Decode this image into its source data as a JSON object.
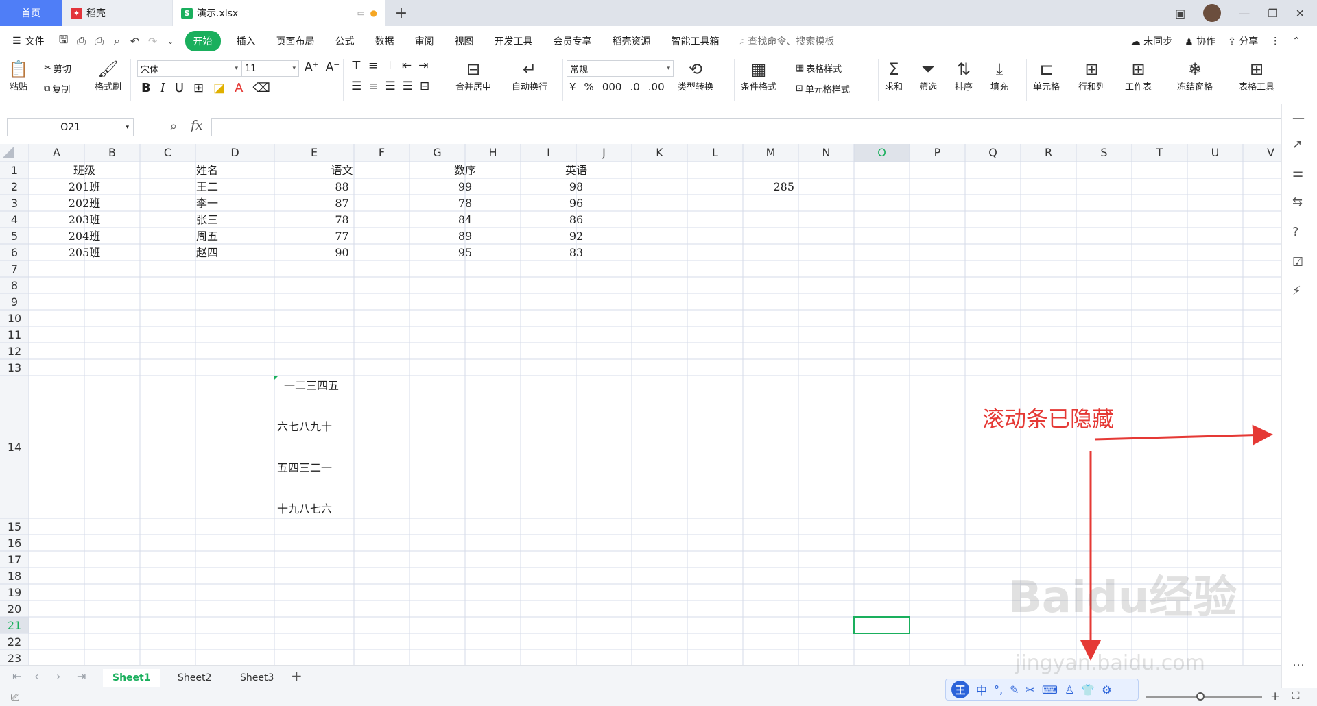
{
  "tabs": {
    "home": "首页",
    "daoke": "稻壳",
    "file": "演示.xlsx"
  },
  "menu": {
    "file": "文件",
    "items": [
      "开始",
      "插入",
      "页面布局",
      "公式",
      "数据",
      "审阅",
      "视图",
      "开发工具",
      "会员专享",
      "稻壳资源",
      "智能工具箱"
    ],
    "search_placeholder": "查找命令、搜索模板",
    "sync": "未同步",
    "collab": "协作",
    "share": "分享"
  },
  "ribbon": {
    "paste": "粘贴",
    "cut": "剪切",
    "copy": "复制",
    "format_painter": "格式刷",
    "font_name": "宋体",
    "font_size": "11",
    "merge": "合并居中",
    "wrap": "自动换行",
    "number_format": "常规",
    "type_convert": "类型转换",
    "cond_format": "条件格式",
    "table_style": "表格样式",
    "cell_style": "单元格样式",
    "sum": "求和",
    "filter": "筛选",
    "sort": "排序",
    "fill": "填充",
    "cell": "单元格",
    "rowcol": "行和列",
    "sheet": "工作表",
    "freeze": "冻结窗格",
    "table_tools": "表格工具"
  },
  "formula_bar": {
    "name_box": "O21",
    "fx": "fx"
  },
  "grid": {
    "columns": [
      "A",
      "B",
      "C",
      "D",
      "E",
      "F",
      "G",
      "H",
      "I",
      "J",
      "K",
      "L",
      "M",
      "N",
      "O",
      "P",
      "Q",
      "R",
      "S",
      "T",
      "U",
      "V"
    ],
    "rows": [
      "1",
      "2",
      "3",
      "4",
      "5",
      "6",
      "7",
      "8",
      "9",
      "10",
      "11",
      "12",
      "13",
      "14",
      "15",
      "16",
      "17",
      "18",
      "19",
      "20",
      "21",
      "22",
      "23"
    ],
    "active_cell": "O21",
    "header": [
      "班级",
      "姓名",
      "语文",
      "数序",
      "英语"
    ],
    "data": [
      [
        "201班",
        "王二",
        "88",
        "99",
        "98"
      ],
      [
        "202班",
        "李一",
        "87",
        "78",
        "96"
      ],
      [
        "203班",
        "张三",
        "78",
        "84",
        "86"
      ],
      [
        "204班",
        "周五",
        "77",
        "89",
        "92"
      ],
      [
        "205班",
        "赵四",
        "90",
        "95",
        "83"
      ]
    ],
    "m2_value": "285",
    "e14_lines": [
      "一二三四五",
      "六七八九十",
      "五四三二一",
      "十九八七六"
    ]
  },
  "sheets": [
    "Sheet1",
    "Sheet2",
    "Sheet3"
  ],
  "ime": {
    "logo": "王",
    "mode": "中"
  },
  "annotation": "滚动条已隐藏",
  "watermark": "Baidu经验",
  "watermark_url": "jingyan.baidu.com",
  "colors": {
    "accent": "#1aaf5d",
    "home_tab": "#4f7ef7",
    "annotation": "#e53935",
    "grid_line": "#d6dbe8"
  }
}
